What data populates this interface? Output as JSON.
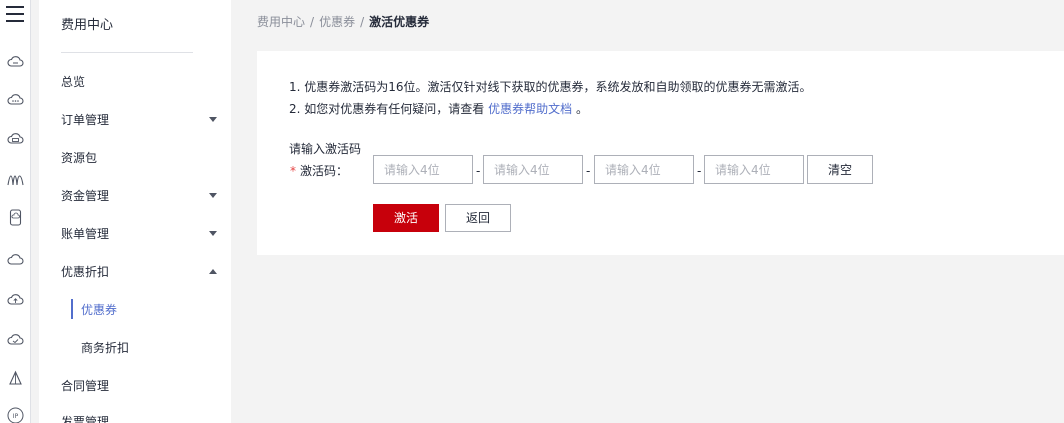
{
  "rail": {
    "icons": [
      "menu-icon",
      "cloud-server-icon",
      "cloud-dots-icon",
      "cloud-storage-icon",
      "wave-icon",
      "mobile-icon",
      "cloud-icon",
      "cloud-upload-icon",
      "cloud-check-icon",
      "bell-icon",
      "ip-icon"
    ],
    "ip_label": "IP"
  },
  "sidebar": {
    "title": "费用中心",
    "items": [
      {
        "label": "总览",
        "caret": "none"
      },
      {
        "label": "订单管理",
        "caret": "down"
      },
      {
        "label": "资源包",
        "caret": "none"
      },
      {
        "label": "资金管理",
        "caret": "down"
      },
      {
        "label": "账单管理",
        "caret": "down"
      },
      {
        "label": "优惠折扣",
        "caret": "up"
      }
    ],
    "subitems": [
      {
        "label": "优惠券",
        "active": true
      },
      {
        "label": "商务折扣",
        "active": false
      }
    ],
    "more": [
      {
        "label": "合同管理"
      },
      {
        "label": "发票管理"
      }
    ]
  },
  "breadcrumb": {
    "items": [
      "费用中心",
      "优惠券"
    ],
    "current": "激活优惠券",
    "separator": "/"
  },
  "notes": {
    "line1": "1. 优惠券激活码为16位。激活仅针对线下获取的优惠券，系统发放和自助领取的优惠券无需激活。",
    "line2_prefix": "2. 如您对优惠券有任何疑问，请查看",
    "line2_link": "优惠券帮助文档",
    "line2_suffix": "。"
  },
  "form": {
    "title": "请输入激活码",
    "required_mark": "*",
    "label": "激活码：",
    "inputs": [
      {
        "placeholder": "请输入4位",
        "value": ""
      },
      {
        "placeholder": "请输入4位",
        "value": ""
      },
      {
        "placeholder": "请输入4位",
        "value": ""
      },
      {
        "placeholder": "请输入4位",
        "value": ""
      }
    ],
    "dash": "-",
    "clear_label": "清空",
    "activate_label": "激活",
    "back_label": "返回"
  },
  "colors": {
    "primary": "#c7000b",
    "link": "#526ecc",
    "required": "#e54545"
  }
}
